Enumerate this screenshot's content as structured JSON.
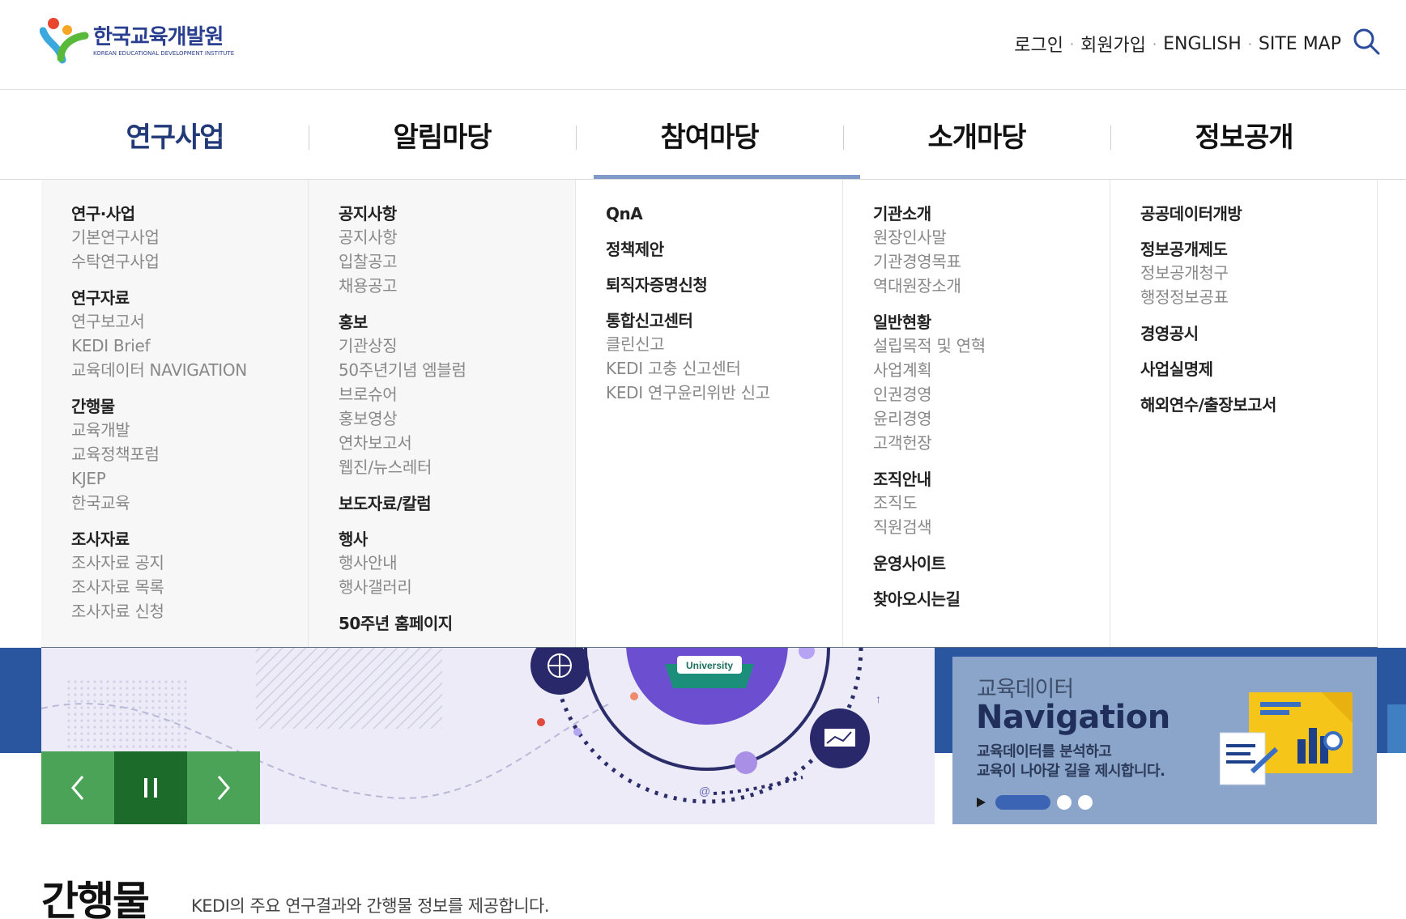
{
  "header": {
    "logo_ko": "한국교육개발원",
    "logo_en": "KOREAN EDUCATIONAL DEVELOPMENT INSTITUTE",
    "util_links": [
      "로그인",
      "회원가입",
      "ENGLISH",
      "SITE MAP"
    ],
    "separator": "·"
  },
  "gnb": [
    "연구사업",
    "알림마당",
    "참여마당",
    "소개마당",
    "정보공개"
  ],
  "mega": [
    {
      "groups": [
        {
          "title": "연구·사업",
          "links": [
            "기본연구사업",
            "수탁연구사업"
          ]
        },
        {
          "title": "연구자료",
          "links": [
            "연구보고서",
            "KEDI Brief",
            "교육데이터 NAVIGATION"
          ]
        },
        {
          "title": "간행물",
          "links": [
            "교육개발",
            "교육정책포럼",
            "KJEP",
            "한국교육"
          ]
        },
        {
          "title": "조사자료",
          "links": [
            "조사자료 공지",
            "조사자료 목록",
            "조사자료 신청"
          ]
        }
      ]
    },
    {
      "groups": [
        {
          "title": "공지사항",
          "links": [
            "공지사항",
            "입찰공고",
            "채용공고"
          ]
        },
        {
          "title": "홍보",
          "links": [
            "기관상징",
            "50주년기념 엠블럼",
            "브로슈어",
            "홍보영상",
            "연차보고서",
            "웹진/뉴스레터"
          ]
        },
        {
          "title": "보도자료/칼럼",
          "links": []
        },
        {
          "title": "행사",
          "links": [
            "행사안내",
            "행사갤러리"
          ]
        },
        {
          "title": "50주년 홈페이지",
          "links": []
        }
      ]
    },
    {
      "groups": [
        {
          "title": "QnA",
          "links": []
        },
        {
          "title": "정책제안",
          "links": []
        },
        {
          "title": "퇴직자증명신청",
          "links": []
        },
        {
          "title": "통합신고센터",
          "links": [
            "클린신고",
            "KEDI 고충 신고센터",
            "KEDI 연구윤리위반 신고"
          ]
        }
      ]
    },
    {
      "groups": [
        {
          "title": "기관소개",
          "links": [
            "원장인사말",
            "기관경영목표",
            "역대원장소개"
          ]
        },
        {
          "title": "일반현황",
          "links": [
            "설립목적 및 연혁",
            "사업계획",
            "인권경영",
            "윤리경영",
            "고객헌장"
          ]
        },
        {
          "title": "조직안내",
          "links": [
            "조직도",
            "직원검색"
          ]
        },
        {
          "title": "운영사이트",
          "links": []
        },
        {
          "title": "찾아오시는길",
          "links": []
        }
      ]
    },
    {
      "groups": [
        {
          "title": "공공데이터개방",
          "links": []
        },
        {
          "title": "정보공개제도",
          "links": [
            "정보공개청구",
            "행정정보공표"
          ]
        },
        {
          "title": "경영공시",
          "links": []
        },
        {
          "title": "사업실명제",
          "links": []
        },
        {
          "title": "해외연수/출장보고서",
          "links": []
        }
      ]
    }
  ],
  "hero": {
    "badge": "University",
    "controls": [
      "prev-icon",
      "pause-icon",
      "next-icon"
    ]
  },
  "side_banner": {
    "title1": "교육데이터",
    "title2": "Navigation",
    "desc1": "교육데이터를 분석하고",
    "desc2": "교육이 나아갈 길을 제시합니다."
  },
  "section": {
    "title": "간행물",
    "desc": "KEDI의 주요 연구결과와 간행물 정보를 제공합니다."
  },
  "colors": {
    "brand_navy": "#223a78",
    "gnb_underline": "#7f99c9",
    "banner_blue": "#2a559f",
    "control_green": "#4aa356",
    "control_green_dark": "#1d6b2a"
  }
}
